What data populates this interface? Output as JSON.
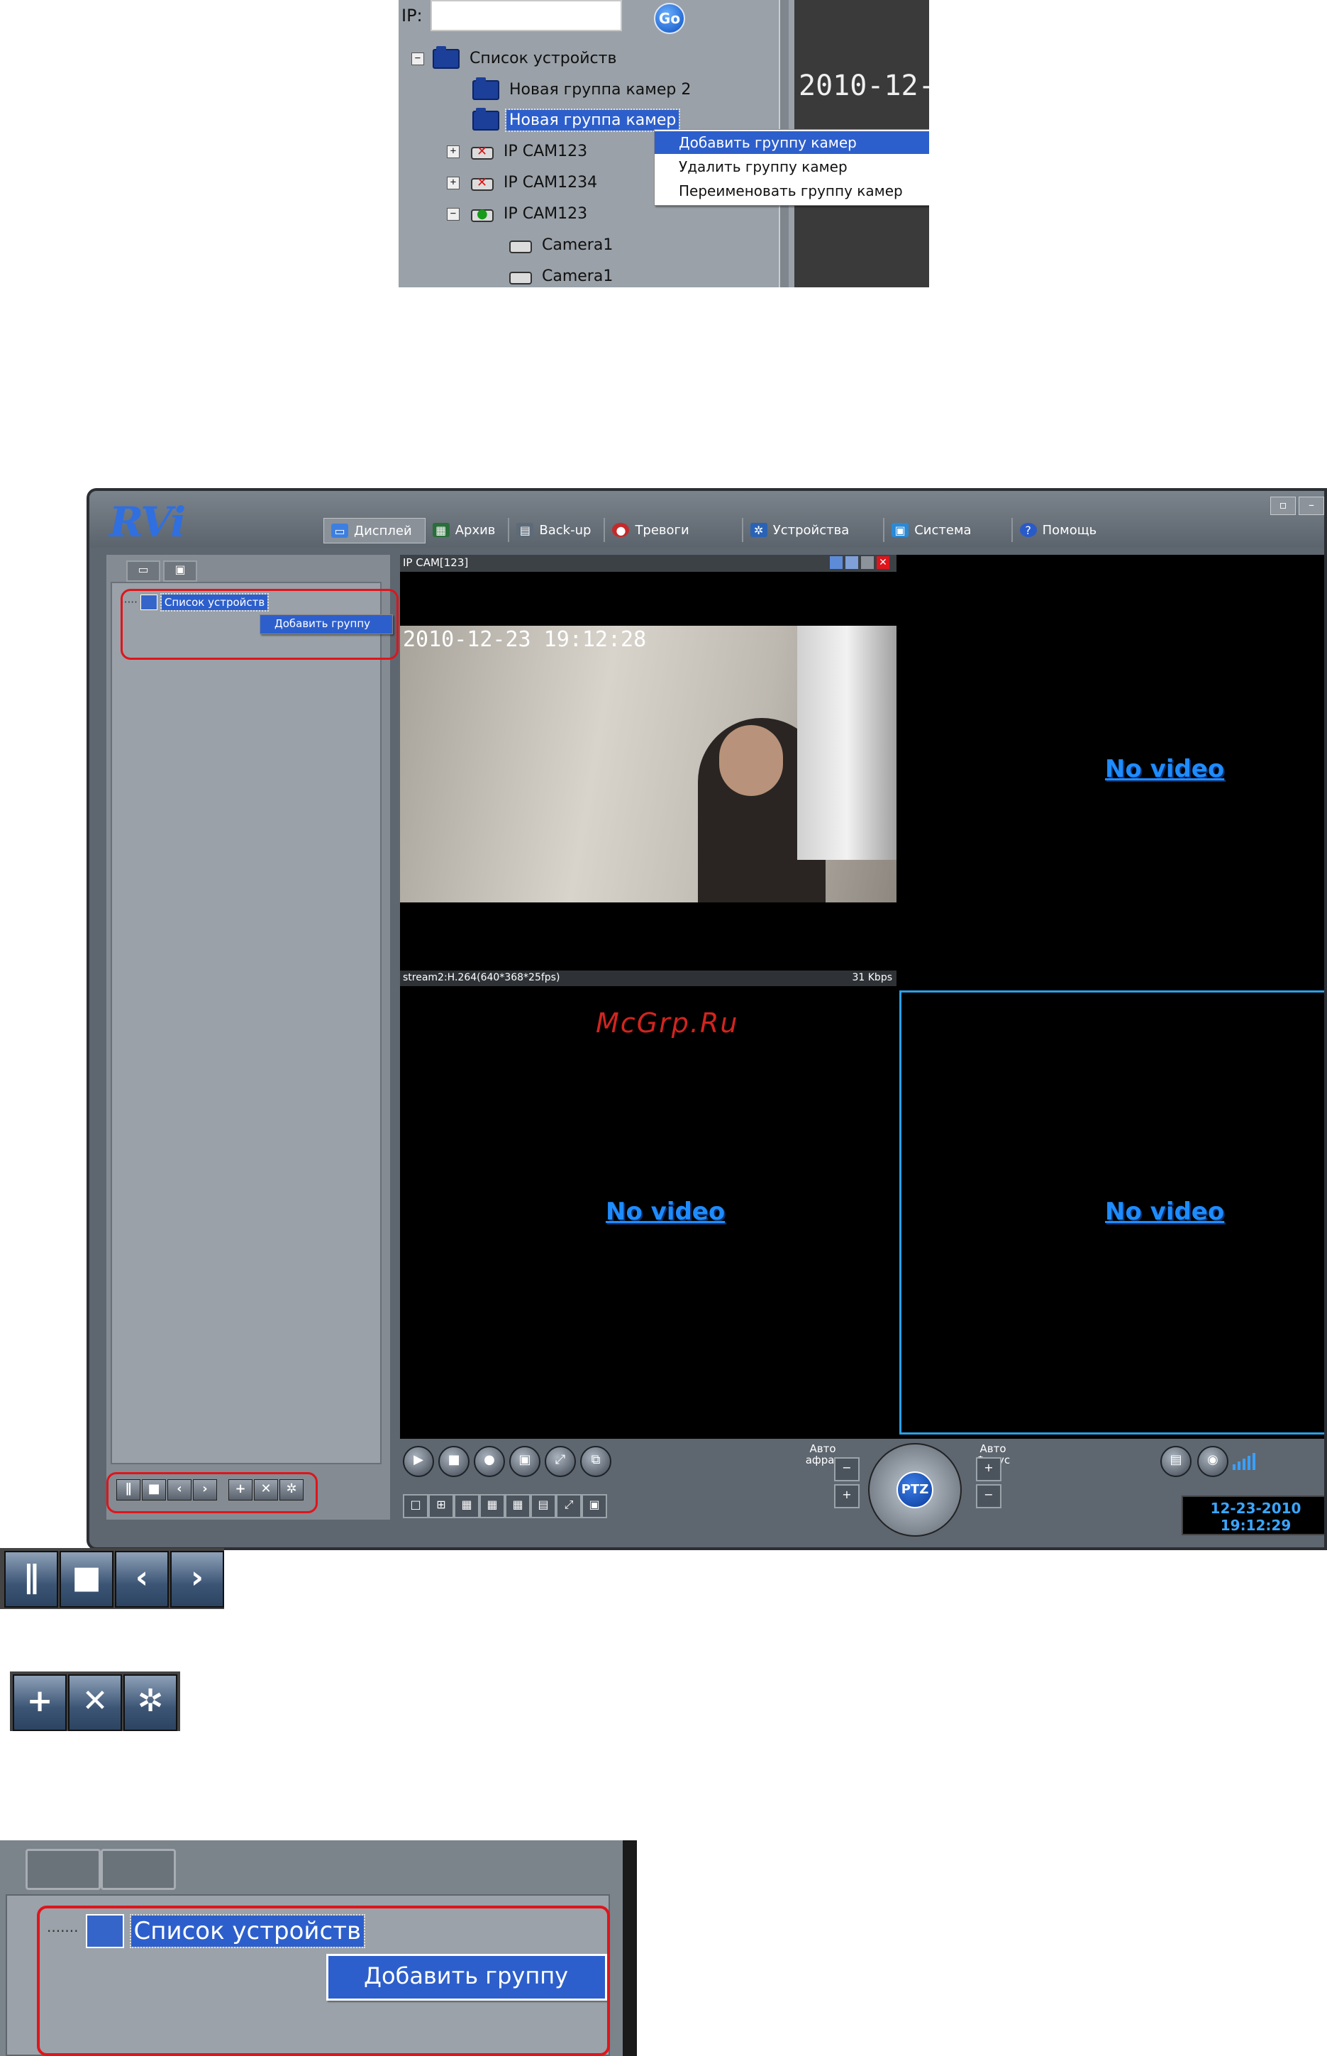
{
  "tree_shot": {
    "ip_label": "IP:",
    "ip_value": "",
    "go_label": "Go",
    "video_timestamp": "2010-12-",
    "tree": [
      {
        "label": "Список устройств",
        "toggle": "−",
        "icon": "folder-icon"
      },
      {
        "label": "Новая группа камер  2",
        "icon": "folder-icon"
      },
      {
        "label": "Новая группа камер",
        "icon": "folder-icon",
        "selected": true
      },
      {
        "label": "IP CAM123",
        "toggle": "+",
        "icon": "camera-offline-icon"
      },
      {
        "label": "IP CAM1234",
        "toggle": "+",
        "icon": "camera-offline-icon"
      },
      {
        "label": "IP CAM123",
        "toggle": "−",
        "icon": "camera-online-icon"
      },
      {
        "label": "Camera1",
        "icon": "camera-icon"
      },
      {
        "label": "Camera1",
        "icon": "camera-icon"
      }
    ],
    "context_menu": [
      "Добавить группу камер",
      "Удалить группу камер",
      "Переименовать группу камер"
    ]
  },
  "app": {
    "logo": "RVi",
    "menu": [
      {
        "label": "Дисплей",
        "icon": "display-icon",
        "active": true
      },
      {
        "label": "Архив",
        "icon": "archive-icon"
      },
      {
        "label": "Back-up",
        "icon": "backup-icon"
      },
      {
        "label": "Тревоги",
        "icon": "alarm-icon"
      },
      {
        "label": "Устройства",
        "icon": "devices-icon"
      },
      {
        "label": "Система",
        "icon": "system-icon"
      },
      {
        "label": "Помощь",
        "icon": "help-icon"
      }
    ],
    "tree_root": "Список устройств",
    "context_item": "Добавить группу",
    "camera_title": "IP CAM[123]",
    "osd_timestamp": "2010-12-23 19:12:28",
    "stream_info": "stream2:H.264(640*368*25fps)",
    "bitrate": "31 Kbps",
    "no_video": "No video",
    "ptz_label": "PTZ",
    "auto_aperture": "Авто афраг",
    "auto_focus": "Авто Фокус",
    "clock_date": "12-23-2010",
    "clock_time": "19:12:29",
    "watermark": "McGrp.Ru",
    "colors": {
      "accent": "#2d5fcc",
      "highlight": "#e0141b",
      "no_video": "#1e8cff"
    }
  },
  "zoom_tree": {
    "root": "Список устройств",
    "context_item": "Добавить группу"
  }
}
